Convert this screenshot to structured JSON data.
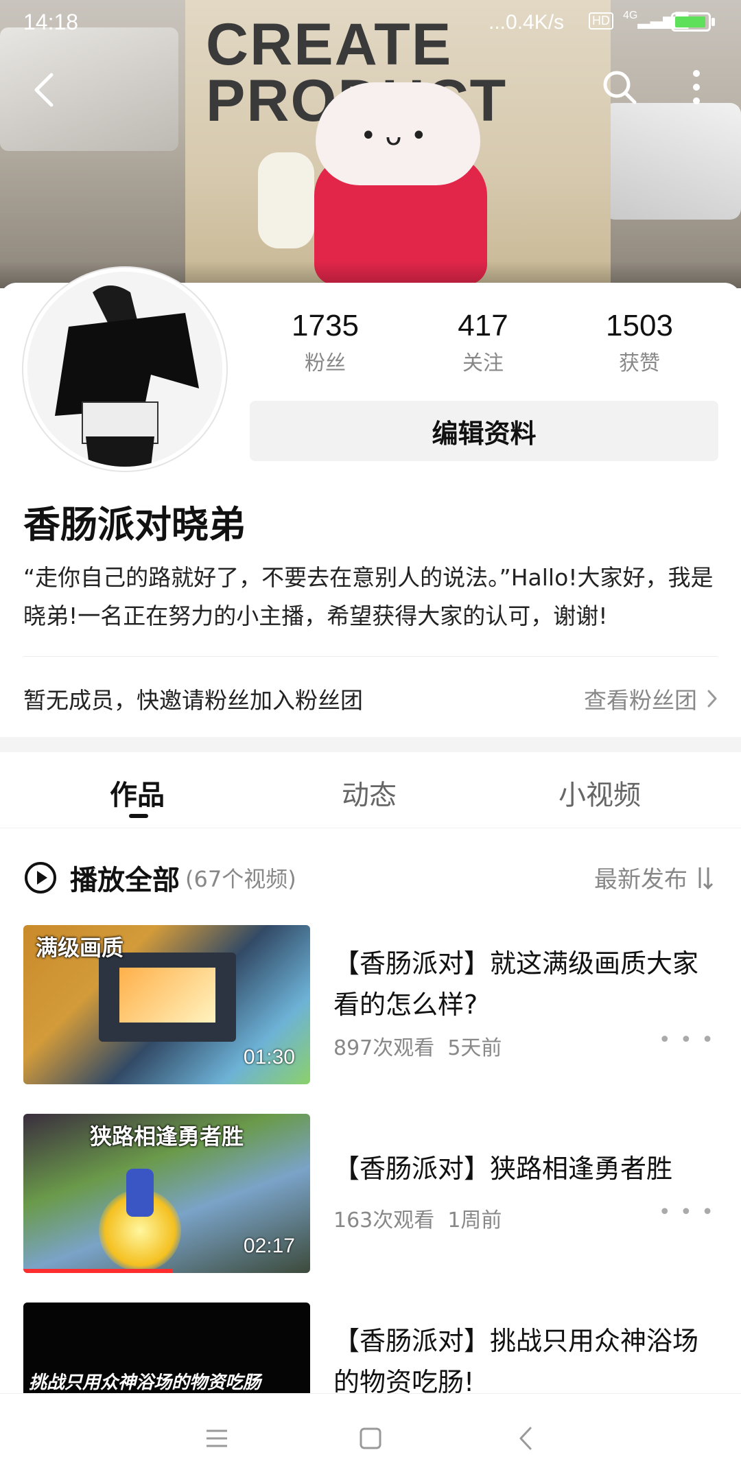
{
  "status_bar": {
    "time": "14:18",
    "net_speed": "...0.4K/s",
    "hd": "HD",
    "signal": "4G"
  },
  "banner": {
    "bag_text_line1": "CREATE",
    "bag_text_line2": "PRODUCT"
  },
  "profile": {
    "stats": [
      {
        "value": "1735",
        "label": "粉丝"
      },
      {
        "value": "417",
        "label": "关注"
      },
      {
        "value": "1503",
        "label": "获赞"
      }
    ],
    "edit_label": "编辑资料",
    "name": "香肠派对晓弟",
    "bio": "“走你自己的路就好了，不要去在意别人的说法。”Hallo!大家好，我是晓弟!一名正在努力的小主播，希望获得大家的认可，谢谢!",
    "fanclub_text": "暂无成员，快邀请粉丝加入粉丝团",
    "fanclub_link": "查看粉丝团"
  },
  "tabs": [
    {
      "label": "作品",
      "active": true
    },
    {
      "label": "动态",
      "active": false
    },
    {
      "label": "小视频",
      "active": false
    }
  ],
  "playlist": {
    "title": "播放全部",
    "count": "(67个视频)",
    "sort_label": "最新发布"
  },
  "videos": [
    {
      "thumb_label": "满级画质",
      "duration": "01:30",
      "title": "【香肠派对】就这满级画质大家看的怎么样?",
      "views": "897次观看",
      "time": "5天前",
      "progress": 0.0
    },
    {
      "thumb_label": "狭路相逢勇者胜",
      "duration": "02:17",
      "title": "【香肠派对】狭路相逢勇者胜",
      "views": "163次观看",
      "time": "1周前",
      "progress": 0.52
    },
    {
      "thumb_label": "挑战只用众神浴场的物资吃肠",
      "duration": "",
      "title": "【香肠派对】挑战只用众神浴场的物资吃肠!",
      "views": "",
      "time": "",
      "progress": 0.0
    }
  ],
  "colors": {
    "accent_red": "#ff2d2d",
    "text_primary": "#111111",
    "text_secondary": "#888888",
    "button_bg": "#f2f2f2"
  },
  "icons": [
    "back-icon",
    "search-icon",
    "more-icon",
    "play-circle-icon",
    "sort-icon",
    "chevron-right-icon",
    "menu-icon",
    "home-icon",
    "nav-back-icon"
  ]
}
